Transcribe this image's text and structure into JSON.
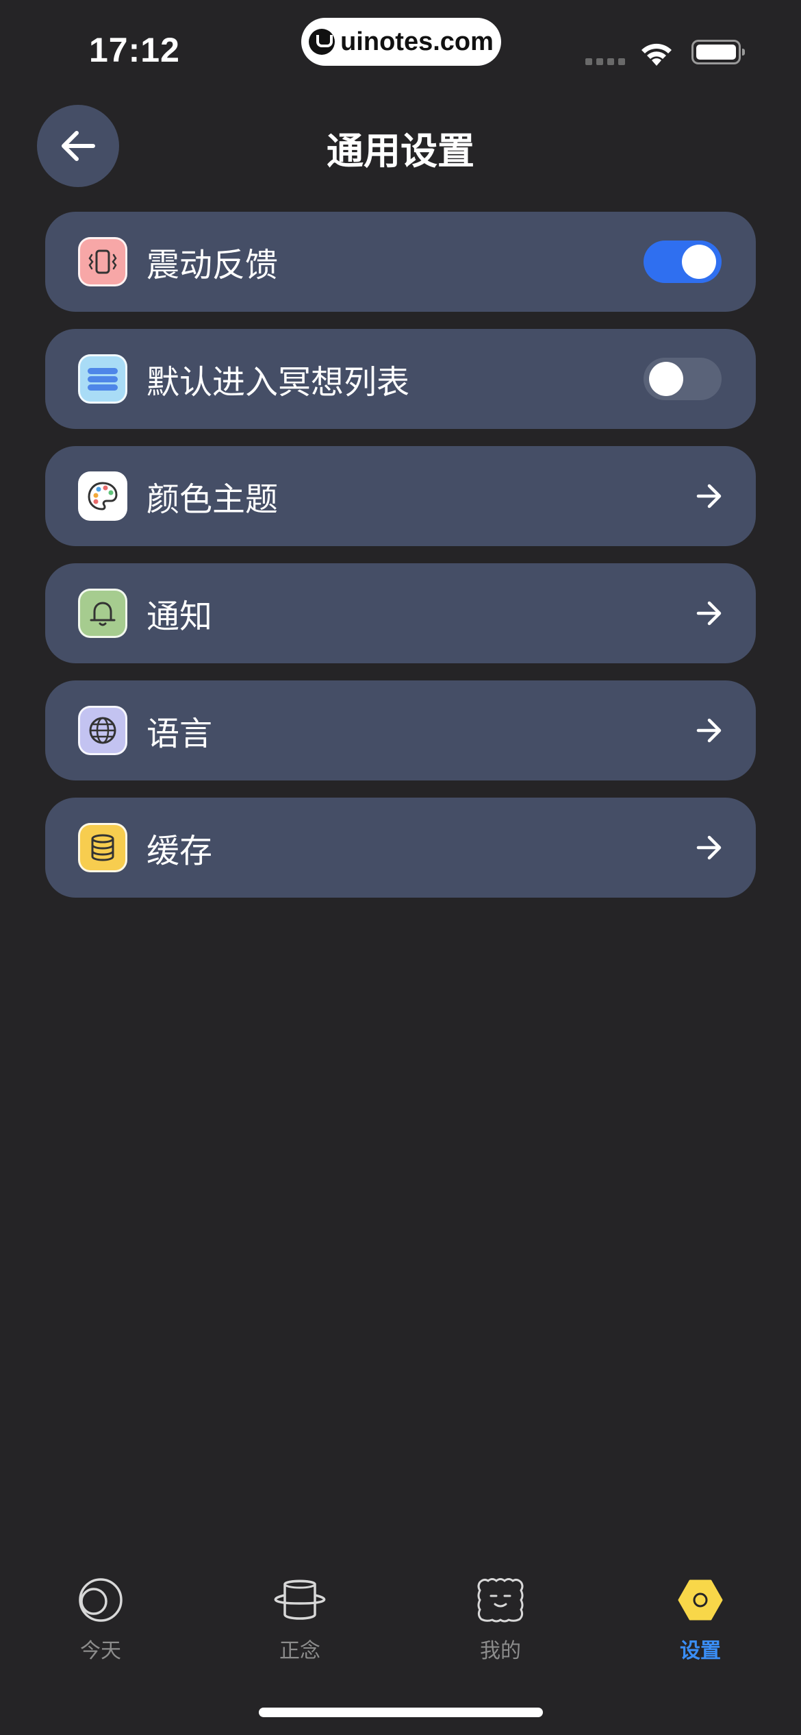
{
  "status_bar": {
    "time": "17:12",
    "watermark": "uinotes.com"
  },
  "header": {
    "title": "通用设置",
    "back_icon": "arrow-left-icon"
  },
  "settings": [
    {
      "id": "vibration",
      "label": "震动反馈",
      "icon": "vibration-icon",
      "icon_bg": "#f7a7a7",
      "control": "toggle",
      "state": "on"
    },
    {
      "id": "meditation-list",
      "label": "默认进入冥想列表",
      "icon": "list-icon",
      "icon_bg": "#a9dcf6",
      "control": "toggle",
      "state": "off"
    },
    {
      "id": "color-theme",
      "label": "颜色主题",
      "icon": "palette-icon",
      "icon_bg": "#ffffff",
      "control": "arrow"
    },
    {
      "id": "notification",
      "label": "通知",
      "icon": "bell-icon",
      "icon_bg": "#a6cc8f",
      "control": "arrow"
    },
    {
      "id": "language",
      "label": "语言",
      "icon": "globe-icon",
      "icon_bg": "#c3c3f1",
      "control": "arrow"
    },
    {
      "id": "cache",
      "label": "缓存",
      "icon": "database-icon",
      "icon_bg": "#f7cd4f",
      "control": "arrow"
    }
  ],
  "tabbar": [
    {
      "label": "今天",
      "icon": "moon-icon",
      "active": false
    },
    {
      "label": "正念",
      "icon": "planet-icon",
      "active": false
    },
    {
      "label": "我的",
      "icon": "face-icon",
      "active": false
    },
    {
      "label": "设置",
      "icon": "hexagon-icon",
      "active": true
    }
  ],
  "colors": {
    "background": "#252426",
    "card": "#454e66",
    "accent": "#2f6ff0",
    "active_tab": "#3a8ef6",
    "tab_hex": "#f8d749"
  }
}
